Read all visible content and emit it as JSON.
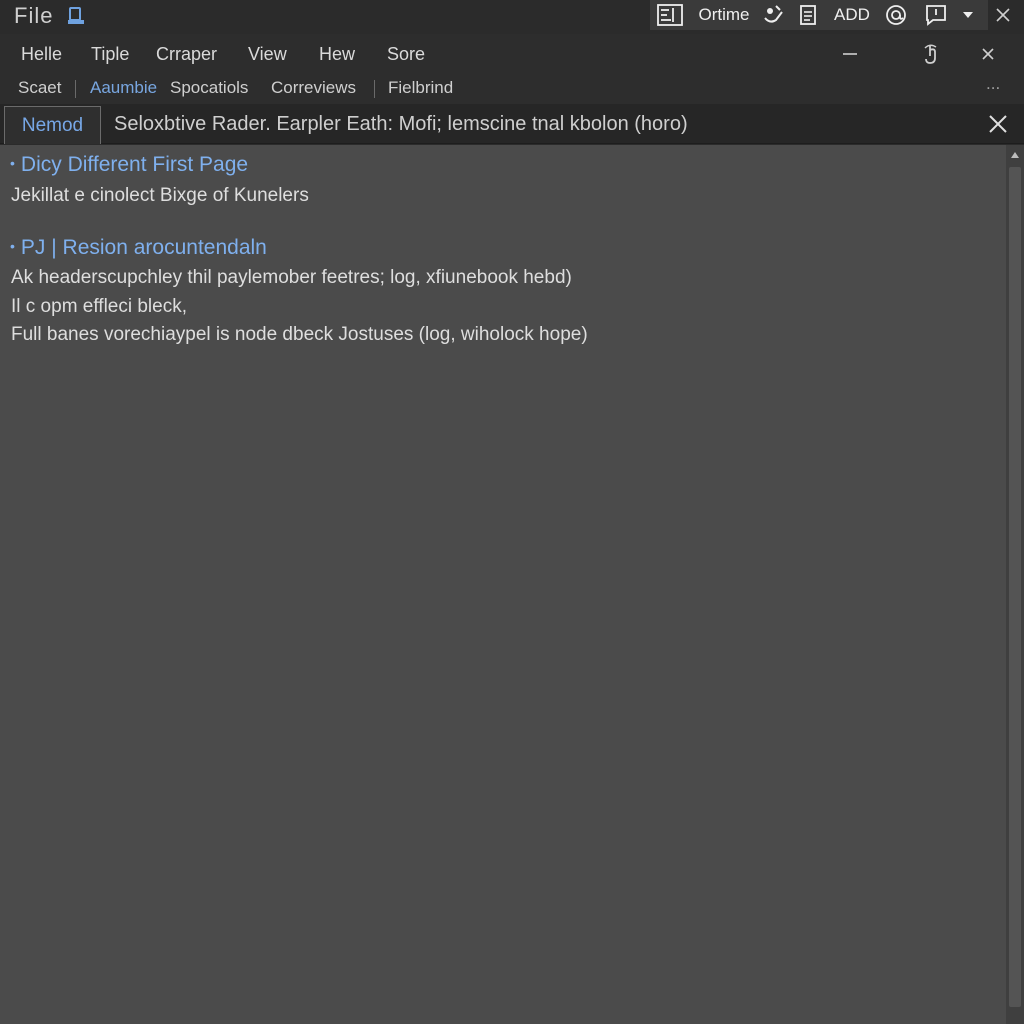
{
  "app": {
    "title": "File"
  },
  "quickbar": {
    "outline_label": "Ortime",
    "add_label": "ADD"
  },
  "menu": {
    "items": [
      "Helle",
      "Tiple",
      "Crraper",
      "View",
      "Hew",
      "Sore"
    ]
  },
  "ribbon": {
    "items": [
      "Scaet",
      "Aaumbie",
      "Spocatiols",
      "Correviews",
      "Fielbrind"
    ],
    "more_label": "..."
  },
  "nav": {
    "tab_label": "Nemod",
    "description": "Seloxbtive Rader. Earpler Eath: Mofi; lemscine tnal kbolon (horo)"
  },
  "content": {
    "sections": [
      {
        "heading": "Dicy Different First Page",
        "lines": [
          "Jekillat e cinolect Bixge of Kunelers"
        ]
      },
      {
        "heading": "PJ | Resion arocuntendaln",
        "lines": [
          "Ak headerscupchley thil paylemober feetres; log, xfiunebook hebd)",
          "Il c opm effleci bleck,",
          "Full banes vorechiaypel is node dbeck Jostuses (log, wiholock hope)"
        ]
      }
    ]
  },
  "colors": {
    "accent": "#7fb0ee",
    "content_bg": "#4b4b4b",
    "chrome_bg": "#2d2d2d"
  },
  "icons": [
    "app-file-icon",
    "outline-view-icon",
    "sparkle-icon",
    "document-icon",
    "at-sign-icon",
    "comment-icon",
    "dropdown-caret-icon",
    "close-icon",
    "minimize-icon",
    "touch-icon",
    "scroll-up-icon"
  ]
}
